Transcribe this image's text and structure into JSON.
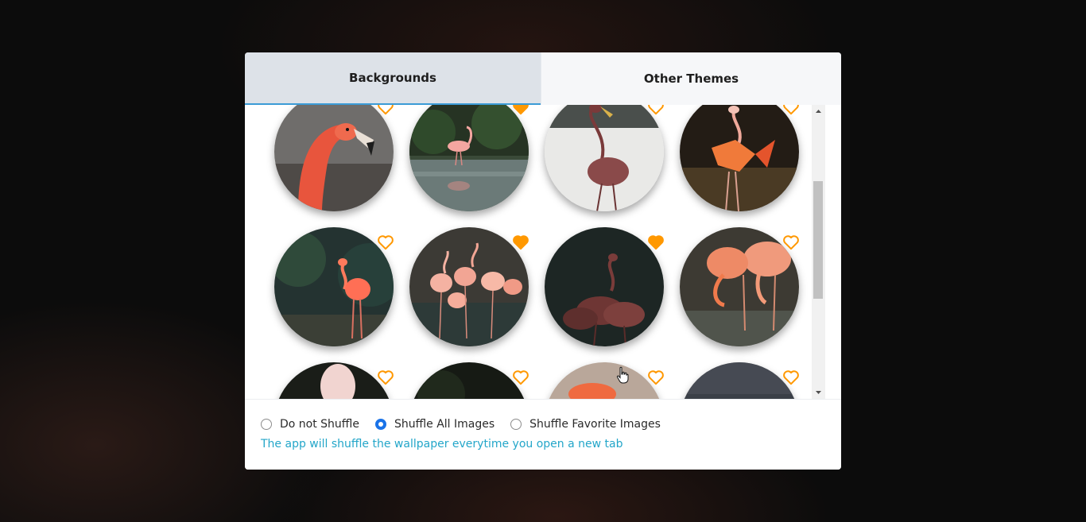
{
  "tabs": {
    "backgrounds": "Backgrounds",
    "other_themes": "Other Themes"
  },
  "gallery": {
    "items": [
      {
        "favorite": false,
        "scene": "flamingo head close-up"
      },
      {
        "favorite": true,
        "scene": "flamingo standing in pond"
      },
      {
        "favorite": false,
        "scene": "single flamingo on light background"
      },
      {
        "favorite": false,
        "scene": "flamingo spreading wings"
      },
      {
        "favorite": false,
        "scene": "flamingo among foliage"
      },
      {
        "favorite": true,
        "scene": "flamingo flock in water"
      },
      {
        "favorite": true,
        "scene": "flamingos on dark background"
      },
      {
        "favorite": false,
        "scene": "flamingos feeding"
      },
      {
        "favorite": false,
        "scene": "white flamingo"
      },
      {
        "favorite": false,
        "scene": "dark foliage"
      },
      {
        "favorite": false,
        "scene": "blurred flamingo"
      },
      {
        "favorite": false,
        "scene": "dark texture"
      }
    ],
    "heart_color": "#ff9800"
  },
  "shuffle": {
    "options": [
      "Do not Shuffle",
      "Shuffle All Images",
      "Shuffle Favorite Images"
    ],
    "selected": "Shuffle All Images",
    "hint": "The app will shuffle the wallpaper everytime you open a new tab"
  },
  "colors": {
    "accent": "#1a73e8",
    "hint": "#23a6c9",
    "tab_active_bg": "#dde2e8"
  }
}
